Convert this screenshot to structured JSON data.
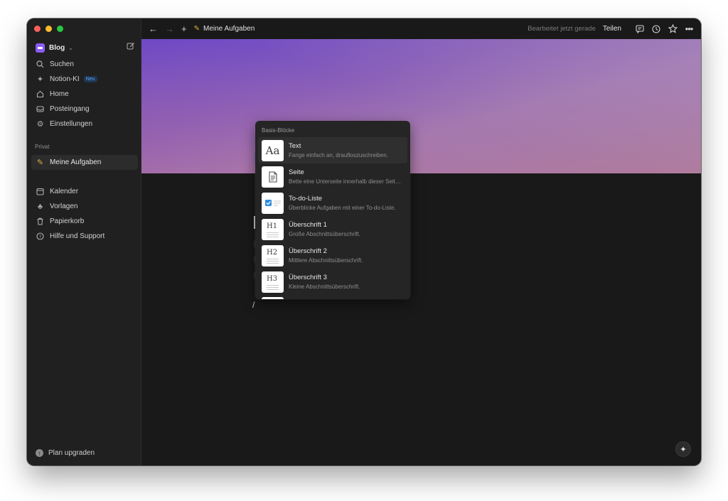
{
  "sidebar": {
    "workspace": {
      "name": "Blog"
    },
    "items": [
      {
        "label": "Suchen",
        "icon": "search-icon"
      },
      {
        "label": "Notion-KI",
        "icon": "sparkle-icon",
        "badge": "Neu"
      },
      {
        "label": "Home",
        "icon": "home-icon"
      },
      {
        "label": "Posteingang",
        "icon": "inbox-icon"
      },
      {
        "label": "Einstellungen",
        "icon": "gear-icon"
      }
    ],
    "section_private": "Privat",
    "pages": [
      {
        "label": "Meine Aufgaben",
        "icon": "page-icon"
      }
    ],
    "footer_items": [
      {
        "label": "Kalender",
        "icon": "calendar-icon"
      },
      {
        "label": "Vorlagen",
        "icon": "templates-icon"
      },
      {
        "label": "Papierkorb",
        "icon": "trash-icon"
      },
      {
        "label": "Hilfe und Support",
        "icon": "help-icon"
      }
    ],
    "upgrade": "Plan upgraden"
  },
  "topbar": {
    "breadcrumb": "Meine Aufgaben",
    "edited": "Bearbeitet jetzt gerade",
    "share": "Teilen"
  },
  "editor": {
    "slash": "/"
  },
  "menu": {
    "title": "Basis-Blöcke",
    "items": [
      {
        "label": "Text",
        "desc": "Fange einfach an, drauflos­zuschreiben."
      },
      {
        "label": "Seite",
        "desc": "Bette eine Unterseite innerhalb dieser Seite ein."
      },
      {
        "label": "To-do-Liste",
        "desc": "Überblicke Aufgaben mit einer To-do-Liste."
      },
      {
        "label": "Überschrift 1",
        "desc": "Große Abschnittsüberschrift."
      },
      {
        "label": "Überschrift 2",
        "desc": "Mittlere Abschnittsüberschrift."
      },
      {
        "label": "Überschrift 3",
        "desc": "Kleine Abschnittsüberschrift."
      }
    ],
    "thumb_text": {
      "aa": "Aa",
      "h1": "H1",
      "h2": "H2",
      "h3": "H3"
    }
  },
  "colors": {
    "window_bg": "#191919",
    "sidebar_bg": "#202020",
    "accent_badge": "#5aa2f0",
    "cover_start": "#6a47c8",
    "cover_end": "#b07a9a"
  }
}
